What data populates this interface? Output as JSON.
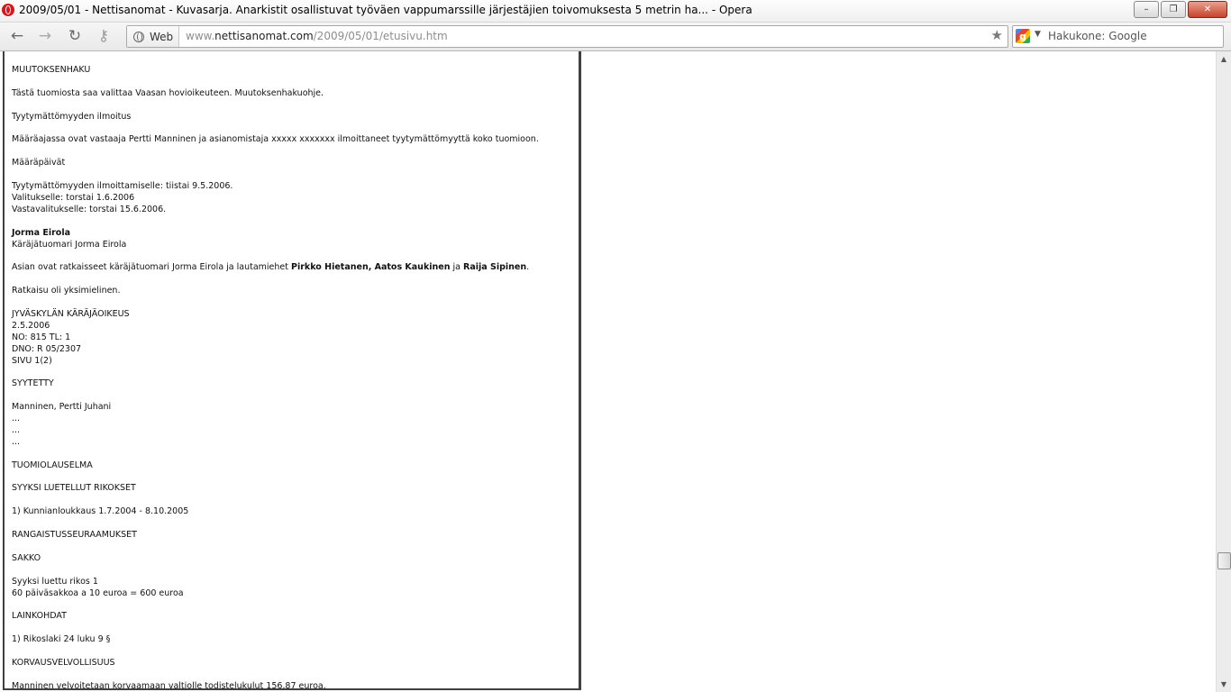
{
  "window": {
    "title": "2009/05/01 - Nettisanomat - Kuvasarja. Anarkistit osallistuvat työväen vappumarssille järjestäjien toivomuksesta 5 metrin ha... - Opera",
    "minimize_glyph": "–",
    "restore_glyph": "❐",
    "close_glyph": "✕"
  },
  "toolbar": {
    "back_glyph": "←",
    "forward_glyph": "→",
    "reload_glyph": "↻",
    "key_glyph": "⚷",
    "web_label": "Web",
    "url_prefix": "www.",
    "url_host": "nettisanomat.com",
    "url_path": "/2009/05/01/etusivu.htm",
    "star_glyph": "★",
    "search_engine_letter": "g",
    "search_arrow": "▼",
    "search_placeholder": "Hakukone: Google"
  },
  "article": {
    "muutoksenhaku_heading": "MUUTOKSENHAKU",
    "muutoksenhaku_text": "Tästä tuomiosta saa valittaa Vaasan hovioikeuteen. Muutoksenhakuohje.",
    "tyytymattomyys_heading": "Tyytymättömyyden ilmoitus",
    "tyytymattomyys_text": "Määräajassa ovat vastaaja Pertti Manninen ja asianomistaja xxxxx xxxxxxx ilmoittaneet tyytymättömyyttä koko tuomioon.",
    "maarapaivat_heading": "Määräpäivät",
    "maarapaivat_line1": "Tyytymättömyyden ilmoittamiselle: tiistai 9.5.2006.",
    "maarapaivat_line2": "Valitukselle: torstai 1.6.2006",
    "maarapaivat_line3": "Vastavalitukselle: torstai 15.6.2006.",
    "signer_name": "Jorma Eirola",
    "signer_title": "Käräjätuomari Jorma Eirola",
    "ratkaisijat_prefix": "Asian ovat ratkaisseet käräjätuomari Jorma Eirola ja lautamiehet ",
    "ratkaisijat_names1": "Pirkko Hietanen, Aatos Kaukinen",
    "ratkaisijat_and": " ja ",
    "ratkaisijat_names2": "Raija  Sipinen",
    "ratkaisijat_suffix": ".",
    "yksimielinen": "Ratkaisu oli yksimielinen.",
    "court_name": "JYVÄSKYLÄN KÄRÄJÄOIKEUS",
    "court_date": "2.5.2006",
    "court_no": "NO: 815 TL: 1",
    "court_dno": "DNO: R 05/2307",
    "court_page": "SIVU 1(2)",
    "syytetty_heading": "SYYTETTY",
    "syytetty_name": "Manninen, Pertti Juhani",
    "ellipsis1": "...",
    "ellipsis2": "...",
    "ellipsis3": "...",
    "tuomiolauselma": "TUOMIOLAUSELMA",
    "rikokset_heading": "SYYKSI LUETELLUT RIKOKSET",
    "rikos1": "1) Kunnianloukkaus 1.7.2004 - 8.10.2005",
    "seuraamukset_heading": "RANGAISTUSSEURAAMUKSET",
    "sakko_heading": "SAKKO",
    "sakko_line1": "Syyksi luettu rikos 1",
    "sakko_line2": "60 päiväsakkoa a 10 euroa = 600 euroa",
    "lainkohdat_heading": "LAINKOHDAT",
    "lainkohta1": "1) Rikoslaki 24 luku 9 §",
    "korvaus_heading": "KORVAUSVELVOLLISUUS",
    "korvaus_text": "Manninen velvoitetaan korvaamaan valtiolle todistelukulut 156,87 euroa."
  },
  "scrollbar": {
    "up_glyph": "▲",
    "down_glyph": "▼"
  }
}
